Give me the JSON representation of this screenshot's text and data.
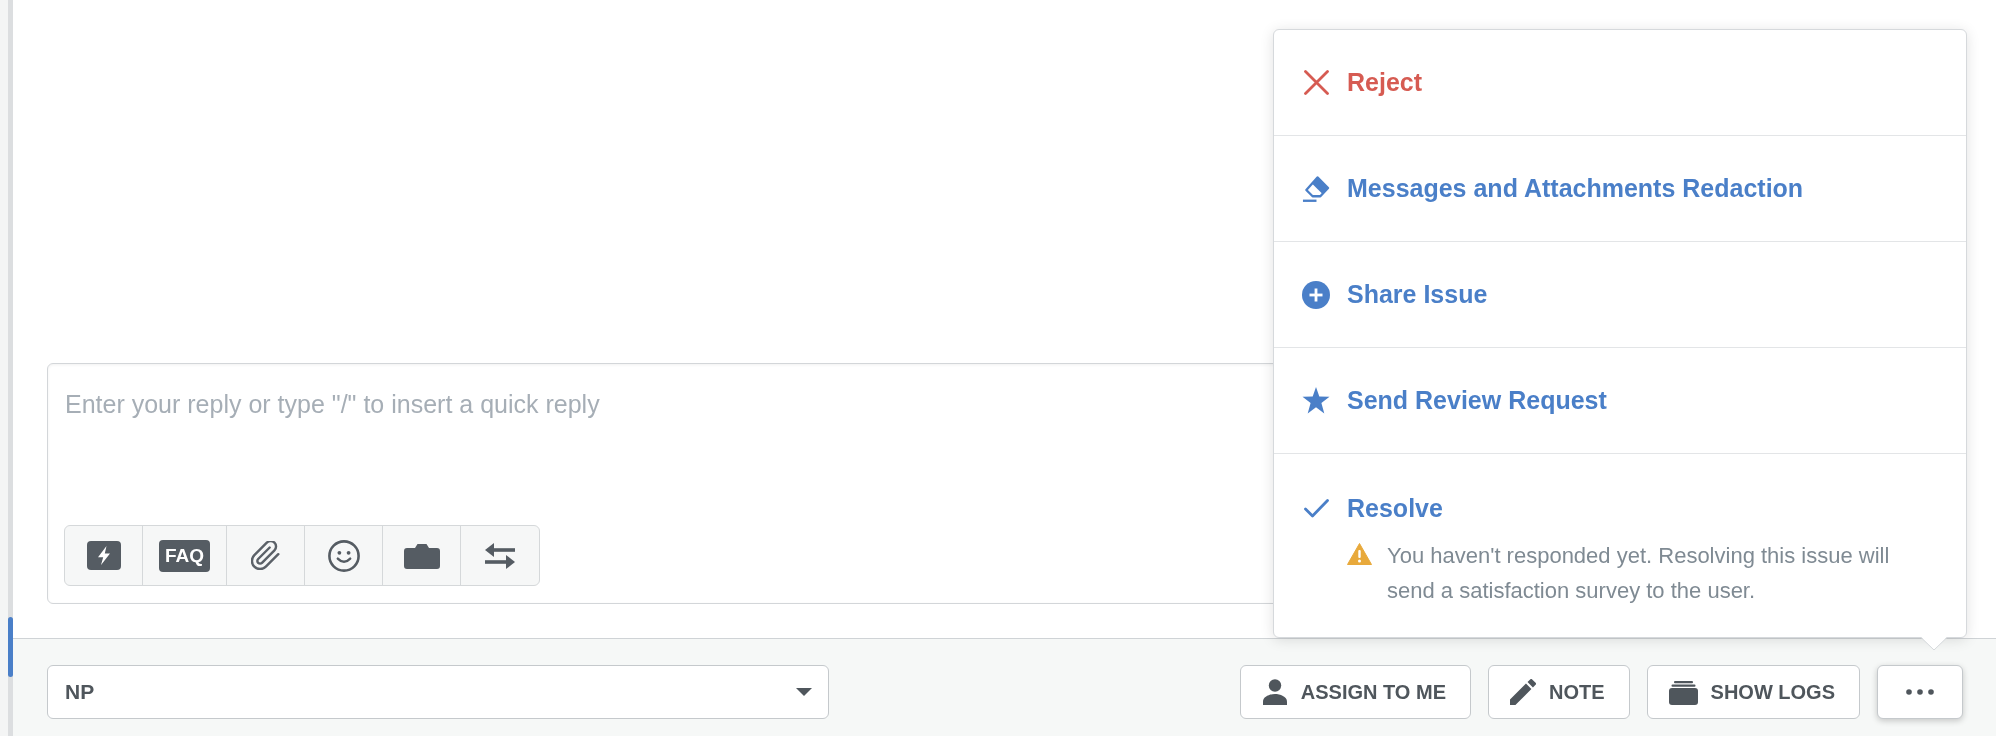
{
  "composer": {
    "placeholder": "Enter your reply or type \"/\" to insert a quick reply",
    "tools": [
      {
        "kind": "quick_reply"
      },
      {
        "kind": "faq",
        "label": "FAQ"
      },
      {
        "kind": "attachment"
      },
      {
        "kind": "emoji"
      },
      {
        "kind": "camera"
      },
      {
        "kind": "transfer"
      }
    ]
  },
  "footer": {
    "assignee_dropdown": {
      "value": "NP"
    },
    "buttons": [
      {
        "kind": "assign",
        "label": "ASSIGN TO ME"
      },
      {
        "kind": "note",
        "label": "NOTE"
      },
      {
        "kind": "logs",
        "label": "SHOW LOGS"
      }
    ],
    "more_button": {
      "expanded": true,
      "menu": [
        {
          "kind": "reject",
          "label": "Reject",
          "danger": true
        },
        {
          "kind": "redaction",
          "label": "Messages and Attachments Redaction",
          "danger": false
        },
        {
          "kind": "share",
          "label": "Share Issue",
          "danger": false
        },
        {
          "kind": "review",
          "label": "Send Review Request",
          "danger": false
        },
        {
          "kind": "resolve",
          "label": "Resolve",
          "danger": false,
          "warning": "You haven't responded yet. Resolving this issue will send a satisfaction survey to the user."
        }
      ]
    }
  }
}
